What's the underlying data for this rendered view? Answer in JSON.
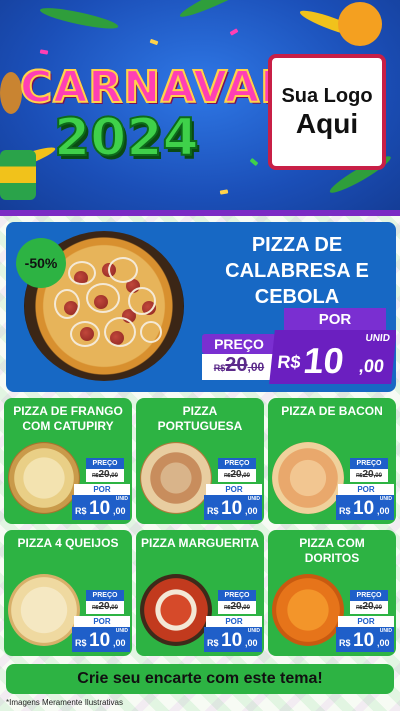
{
  "header": {
    "title": "CARNAVAL",
    "year": "2024",
    "logo_line1": "Sua Logo",
    "logo_line2": "Aqui",
    "colors": {
      "background": "#1b4fb8",
      "title": "#ff3fb4",
      "year": "#3fd14a",
      "band": "#7b2ac4"
    }
  },
  "featured": {
    "discount": "-50%",
    "title": "PIZZA DE CALABRESA E CEBOLA",
    "por_label": "POR",
    "preco_label": "PREÇO",
    "old_price": {
      "currency": "R$",
      "integer": "20",
      "decimal": ",00"
    },
    "unit": "UNID",
    "new_price": {
      "currency": "R$",
      "integer": "10",
      "decimal": ",00"
    },
    "colors": {
      "card": "#1768c4",
      "accent": "#7a2fd1"
    }
  },
  "cards": [
    {
      "name": "PIZZA DE FRANGO COM CATUPIRY",
      "pizza_icon": "pizza-frango-catupiry",
      "preco_label": "PREÇO",
      "old_currency": "R$",
      "old_integer": "20",
      "old_decimal": ",00",
      "por_label": "POR",
      "unit": "UNID",
      "new_currency": "R$",
      "new_integer": "10",
      "new_decimal": ",00"
    },
    {
      "name": "PIZZA PORTUGUESA",
      "pizza_icon": "pizza-portuguesa",
      "preco_label": "PREÇO",
      "old_currency": "R$",
      "old_integer": "20",
      "old_decimal": ",00",
      "por_label": "POR",
      "unit": "UNID",
      "new_currency": "R$",
      "new_integer": "10",
      "new_decimal": ",00"
    },
    {
      "name": "PIZZA DE BACON",
      "pizza_icon": "pizza-bacon",
      "preco_label": "PREÇO",
      "old_currency": "R$",
      "old_integer": "20",
      "old_decimal": ",00",
      "por_label": "POR",
      "unit": "UNID",
      "new_currency": "R$",
      "new_integer": "10",
      "new_decimal": ",00"
    },
    {
      "name": "PIZZA 4 QUEIJOS",
      "pizza_icon": "pizza-4-queijos",
      "preco_label": "PREÇO",
      "old_currency": "R$",
      "old_integer": "20",
      "old_decimal": ",00",
      "por_label": "POR",
      "unit": "UNID",
      "new_currency": "R$",
      "new_integer": "10",
      "new_decimal": ",00"
    },
    {
      "name": "PIZZA MARGUERITA",
      "pizza_icon": "pizza-marguerita",
      "preco_label": "PREÇO",
      "old_currency": "R$",
      "old_integer": "20",
      "old_decimal": ",00",
      "por_label": "POR",
      "unit": "UNID",
      "new_currency": "R$",
      "new_integer": "10",
      "new_decimal": ",00"
    },
    {
      "name": "PIZZA COM DORITOS",
      "pizza_icon": "pizza-doritos",
      "preco_label": "PREÇO",
      "old_currency": "R$",
      "old_integer": "20",
      "old_decimal": ",00",
      "por_label": "POR",
      "unit": "UNID",
      "new_currency": "R$",
      "new_integer": "10",
      "new_decimal": ",00"
    }
  ],
  "footer": {
    "cta": "Crie seu encarte com este tema!",
    "disclaimer": "*Imagens Meramente Ilustrativas"
  }
}
